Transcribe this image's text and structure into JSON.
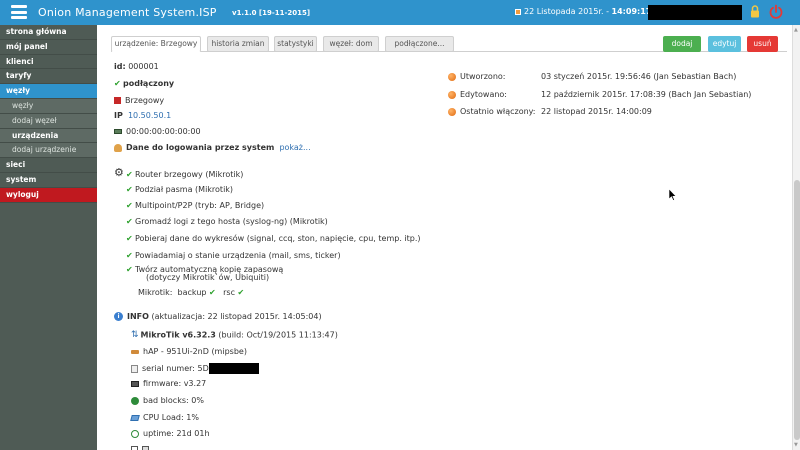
{
  "header": {
    "brand": "Onion Management System.ISP",
    "version": "v1.1.0 [19-11-2015]",
    "date": "22 Listopada 2015r. -",
    "time": "14:09:17"
  },
  "sidebar": {
    "items": [
      {
        "label": "strona główna"
      },
      {
        "label": "mój panel"
      },
      {
        "label": "klienci"
      },
      {
        "label": "taryfy"
      },
      {
        "label": "węzły"
      },
      {
        "label": "węzły"
      },
      {
        "label": "dodaj węzeł"
      },
      {
        "label": "urządzenia"
      },
      {
        "label": "dodaj urządzenie"
      },
      {
        "label": "sieci"
      },
      {
        "label": "system"
      },
      {
        "label": "wyloguj"
      }
    ]
  },
  "tabs": [
    {
      "label": "urządzenie: Brzegowy"
    },
    {
      "label": "historia zmian"
    },
    {
      "label": "statystyki"
    },
    {
      "label": "węzeł: dom"
    },
    {
      "label": "podłączone..."
    }
  ],
  "actions": {
    "add": "dodaj",
    "edit": "edytuj",
    "delete": "usuń"
  },
  "device": {
    "id_label": "id:",
    "id": "000001",
    "status": "podłączony",
    "name": "Brzegowy",
    "ip_label": "IP",
    "ip": "10.50.50.1",
    "mac": "00:00:00:00:00:00",
    "login_label": "Dane do logowania przez system",
    "login_link": "pokaż..."
  },
  "history": {
    "created_label": "Utworzono:",
    "created": "03 styczeń 2015r. 19:56:46 (Jan Sebastian Bach)",
    "edited_label": "Edytowano:",
    "edited": "12 październik 2015r. 17:08:39 (Bach Jan Sebastian)",
    "last_on_label": "Ostatnio włączony:",
    "last_on": "22 listopad 2015r. 14:00:09"
  },
  "features": [
    "Router brzegowy (Mikrotik)",
    "Podział pasma (Mikrotik)",
    "Multipoint/P2P (tryb: AP, Bridge)",
    "Gromadź logi z tego hosta (syslog-ng) (Mikrotik)",
    "Pobieraj dane do wykresów (signal, ccq, ston, napięcie, cpu, temp. itp.)",
    "Powiadamiaj o stanie urządzenia (mail, sms, ticker)",
    "Twórz automatyczną kopię zapasową"
  ],
  "backup_note": "(dotyczy Mikrotik`ów, Ubiquiti)",
  "mikrotik": {
    "label": "Mikrotik:",
    "backup": "backup",
    "rsc": "rsc"
  },
  "info": {
    "title": "INFO",
    "updated": "(aktualizacja: 22 listopad 2015r. 14:05:04)",
    "os": "MikroTik v6.32.3",
    "build": "(build: Oct/19/2015 11:13:47)",
    "model": "hAP - 951Ui-2nD (mipsbe)",
    "serial_label": "serial numer: 5D",
    "firmware": "firmware: v3.27",
    "bad_blocks": "bad blocks: 0%",
    "cpu": "CPU Load: 1%",
    "uptime": "uptime: 21d 01h"
  },
  "colors": {
    "header": "#2f93cc",
    "sidebar": "#4f5b55",
    "active": "#2f93cc",
    "logout": "#c0191f"
  }
}
